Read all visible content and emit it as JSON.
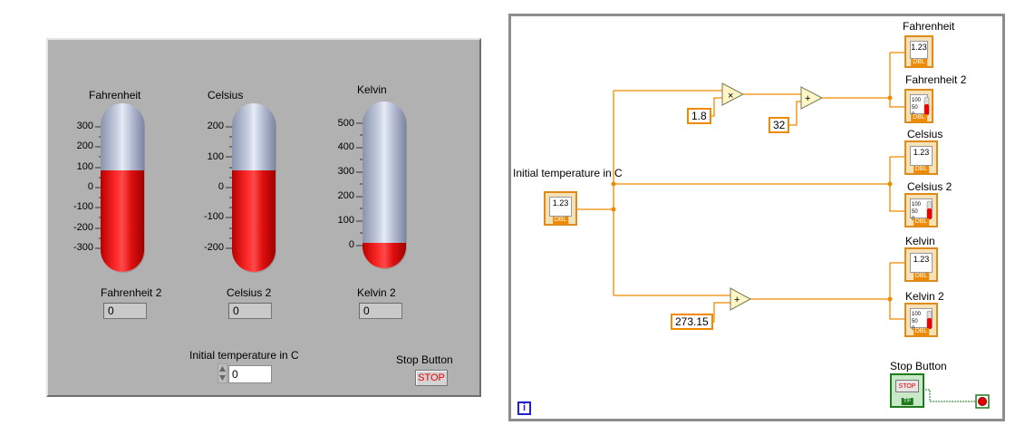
{
  "front_panel": {
    "thermometers": [
      {
        "label": "Fahrenheit",
        "ticks": [
          "300",
          "200",
          "100",
          "0",
          "-100",
          "-200",
          "-300"
        ],
        "level": 0.5
      },
      {
        "label": "Celsius",
        "ticks": [
          "200",
          "100",
          "0",
          "-100",
          "-200"
        ],
        "level": 0.5
      },
      {
        "label": "Kelvin",
        "ticks": [
          "500",
          "400",
          "300",
          "200",
          "100",
          "0"
        ],
        "level": 0.0
      }
    ],
    "indicators": [
      {
        "label": "Fahrenheit 2",
        "value": "0"
      },
      {
        "label": "Celsius 2",
        "value": "0"
      },
      {
        "label": "Kelvin 2",
        "value": "0"
      }
    ],
    "initial_temp": {
      "label": "Initial temperature in C",
      "value": "0"
    },
    "stop": {
      "label": "Stop Button",
      "button_text": "STOP"
    },
    "colors": {
      "panel": "#b1b1b1",
      "mercury": "#ff2020",
      "tube": "#c9d0e2"
    }
  },
  "block_diagram": {
    "constants": {
      "factor": "1.8",
      "offset": "32",
      "kelvin_offset": "273.15"
    },
    "terminal_labels": {
      "fahrenheit": "Fahrenheit",
      "fahrenheit2": "Fahrenheit 2",
      "celsius": "Celsius",
      "celsius2": "Celsius 2",
      "kelvin": "Kelvin",
      "kelvin2": "Kelvin 2",
      "initial": "Initial temperature in C",
      "stop": "Stop Button"
    },
    "numeric_glyph": "1.23",
    "dbl_tag": "DBL",
    "tf_tag": "TF",
    "stop_glyph": "STOP",
    "thermo_glyph": [
      "100",
      "50",
      "0"
    ],
    "loop_index": "i",
    "ops": {
      "multiply": "×",
      "add": "+"
    },
    "colors": {
      "wire": "#f08a00",
      "bool_wire": "#1d7a1d"
    }
  }
}
